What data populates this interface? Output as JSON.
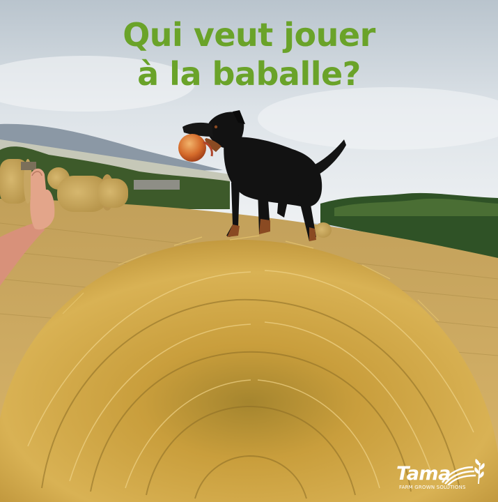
{
  "ad": {
    "headline_line1": "Qui veut jouer",
    "headline_line2": "à la baballe?"
  },
  "brand": {
    "name": "Tama",
    "tagline": "FARM GROWN SOLUTIONS"
  },
  "colors": {
    "headline": "#6aa329",
    "logo": "#ffffff",
    "straw": "#d6ad4e",
    "dog_coat": "#121212"
  },
  "icons": [
    "tama-logo-mark-icon"
  ]
}
